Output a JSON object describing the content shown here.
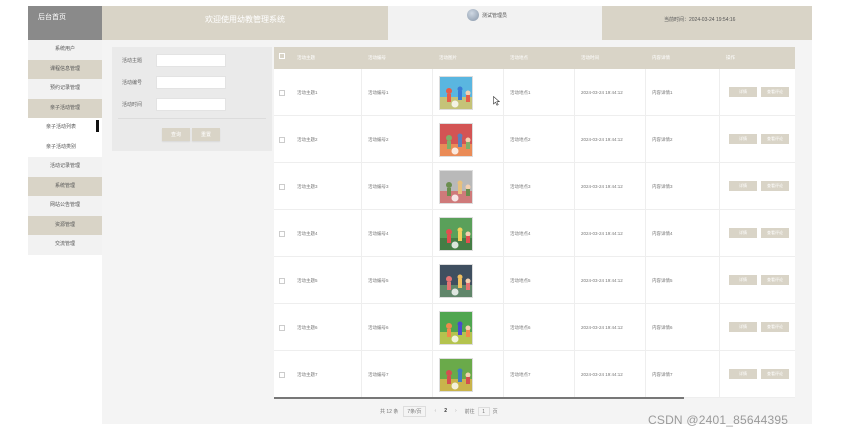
{
  "header": {
    "brand": "后台首页",
    "title": "欢迎使用幼教管理系统",
    "user": "测试管理员",
    "time": "当前时间：2024-03-24 19:54:16"
  },
  "sidebar": {
    "items": [
      {
        "label": "系统用户",
        "style": "light"
      },
      {
        "label": "课程信息管理",
        "style": "dark"
      },
      {
        "label": "预约记录管理",
        "style": "light"
      },
      {
        "label": "亲子活动管理",
        "style": "dark"
      },
      {
        "label": "亲子活动列表",
        "style": "sub",
        "active": true
      },
      {
        "label": "亲子活动类别",
        "style": "sub"
      },
      {
        "label": "活动记录管理",
        "style": "light"
      },
      {
        "label": "系统管理",
        "style": "dark"
      },
      {
        "label": "网站公告管理",
        "style": "light"
      },
      {
        "label": "资源管理",
        "style": "dark"
      },
      {
        "label": "交流管理",
        "style": "light"
      }
    ]
  },
  "search": {
    "fields": [
      {
        "label": "活动主题",
        "value": ""
      },
      {
        "label": "活动编号",
        "value": ""
      },
      {
        "label": "活动时间",
        "value": ""
      }
    ],
    "query_label": "查询",
    "reset_label": "重置"
  },
  "table": {
    "columns": [
      "活动主题",
      "活动编号",
      "活动图片",
      "活动地点",
      "活动时间",
      "内容详情",
      "操作"
    ],
    "rows": [
      {
        "theme": "活动主题1",
        "code": "活动编号1",
        "place": "活动地点1",
        "time": "2024-03-24 19:44:12",
        "detail": "内容详情1",
        "scene": "ball"
      },
      {
        "theme": "活动主题2",
        "code": "活动编号2",
        "place": "活动地点2",
        "time": "2024-03-24 19:44:12",
        "detail": "内容详情2",
        "scene": "group"
      },
      {
        "theme": "活动主题3",
        "code": "活动编号3",
        "place": "活动地点3",
        "time": "2024-03-24 19:44:12",
        "detail": "内容详情3",
        "scene": "hoop"
      },
      {
        "theme": "活动主题4",
        "code": "活动编号4",
        "place": "活动地点4",
        "time": "2024-03-24 19:44:12",
        "detail": "内容详情4",
        "scene": "field"
      },
      {
        "theme": "活动主题5",
        "code": "活动编号5",
        "place": "活动地点5",
        "time": "2024-03-24 19:44:12",
        "detail": "内容详情5",
        "scene": "indoor"
      },
      {
        "theme": "活动主题6",
        "code": "活动编号6",
        "place": "活动地点6",
        "time": "2024-03-24 19:44:12",
        "detail": "内容详情6",
        "scene": "toy"
      },
      {
        "theme": "活动主题7",
        "code": "活动编号7",
        "place": "活动地点7",
        "time": "2024-03-24 19:44:12",
        "detail": "内容详情7",
        "scene": "play"
      }
    ],
    "edit_label": "详情",
    "review_label": "查看评论"
  },
  "pagination": {
    "total": "共 12 条",
    "page_size": "7条/页",
    "prev": "‹",
    "current": "2",
    "next": "›",
    "goto_label": "前往",
    "goto_value": "1",
    "page_suffix": "页"
  },
  "watermark": "CSDN @2401_85644395",
  "colors": {
    "accent": "#d9d4c7",
    "brand": "#8a8a8a"
  }
}
